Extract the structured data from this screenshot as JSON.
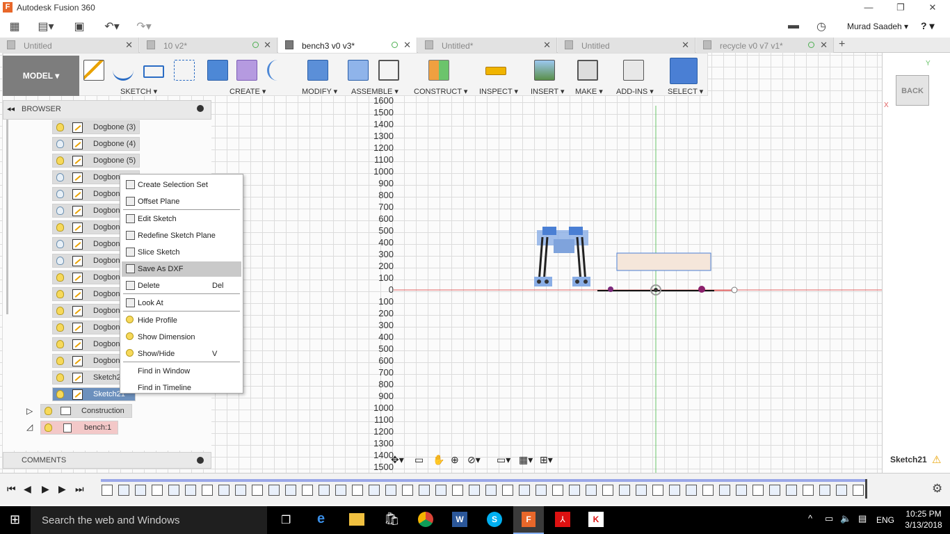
{
  "app": {
    "title": "Autodesk Fusion 360",
    "logo": "F"
  },
  "window": {
    "minimize": "—",
    "restore": "❐",
    "close": "✕"
  },
  "account": {
    "user": "Murad Saadeh ▾",
    "help": "? ▾"
  },
  "tabs": [
    {
      "label": "Untitled",
      "active": false,
      "close": "✕"
    },
    {
      "label": "10 v2*",
      "active": false,
      "close": "✕"
    },
    {
      "label": "bench3 v0 v3*",
      "active": true,
      "close": "✕"
    },
    {
      "label": "Untitled*",
      "active": false,
      "close": "✕"
    },
    {
      "label": "Untitled",
      "active": false,
      "close": "✕"
    },
    {
      "label": "recycle v0 v7 v1*",
      "active": false,
      "close": "✕"
    }
  ],
  "toolbar": {
    "model": "MODEL ▾",
    "groups": [
      "SKETCH ▾",
      "CREATE ▾",
      "MODIFY ▾",
      "ASSEMBLE ▾",
      "CONSTRUCT ▾",
      "INSPECT ▾",
      "INSERT ▾",
      "MAKE ▾",
      "ADD-INS ▾",
      "SELECT ▾"
    ]
  },
  "browser": {
    "title": "BROWSER",
    "items": [
      "Dogbone (3)",
      "Dogbone (4)",
      "Dogbone (5)",
      "Dogbone",
      "Dogbone",
      "Dogbone",
      "Dogbone",
      "Dogbone",
      "Dogbone",
      "Dogbone",
      "Dogbone",
      "Dogbone",
      "Dogbone",
      "Dogbone",
      "Dogbone",
      "Sketch2",
      "Sketch21"
    ],
    "construction": "Construction",
    "component": "bench:1"
  },
  "comments": {
    "title": "COMMENTS"
  },
  "context_menu": [
    {
      "label": "Create Selection Set",
      "shortcut": ""
    },
    {
      "label": "Offset Plane",
      "shortcut": ""
    },
    {
      "label": "Edit Sketch",
      "shortcut": ""
    },
    {
      "label": "Redefine Sketch Plane",
      "shortcut": ""
    },
    {
      "label": "Slice Sketch",
      "shortcut": ""
    },
    {
      "label": "Save As DXF",
      "shortcut": "",
      "highlighted": true
    },
    {
      "label": "Delete",
      "shortcut": "Del"
    },
    {
      "label": "Look At",
      "shortcut": ""
    },
    {
      "label": "Hide Profile",
      "shortcut": ""
    },
    {
      "label": "Show Dimension",
      "shortcut": ""
    },
    {
      "label": "Show/Hide",
      "shortcut": "V"
    },
    {
      "label": "Find in Window",
      "shortcut": ""
    },
    {
      "label": "Find in Timeline",
      "shortcut": ""
    }
  ],
  "y_ticks": [
    "1600",
    "1500",
    "1400",
    "1300",
    "1200",
    "1100",
    "1000",
    "900",
    "800",
    "700",
    "600",
    "500",
    "400",
    "300",
    "200",
    "100",
    "0",
    "100",
    "200",
    "300",
    "400",
    "500",
    "600",
    "700",
    "800",
    "900",
    "1000",
    "1100",
    "1200",
    "1300",
    "1400",
    "1500"
  ],
  "viewcube": {
    "back": "BACK",
    "x": "X",
    "y": "Y"
  },
  "status": {
    "sketch": "Sketch21"
  },
  "taskbar": {
    "search": "Search the web and Windows",
    "time": "10:25 PM",
    "date": "3/13/2018",
    "lang": "ENG"
  },
  "colors": {
    "accent": "#6c90bd",
    "selected_blue": "#4a7fd4",
    "highlight": "#c9c9c9"
  }
}
